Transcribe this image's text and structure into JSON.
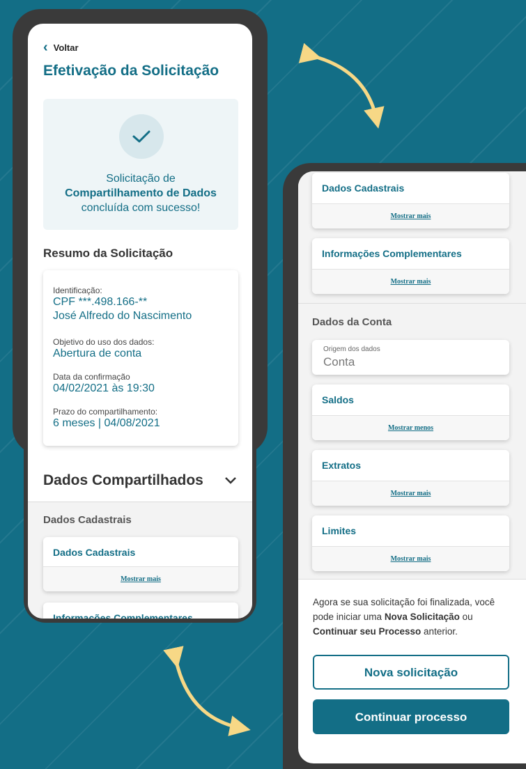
{
  "colors": {
    "accent": "#136e86",
    "background": "#136e86",
    "arrow": "#f7d886"
  },
  "left_screen": {
    "back_label": "Voltar",
    "title": "Efetivação da Solicitação",
    "success": {
      "line1": "Solicitação de",
      "line2": "Compartilhamento de Dados",
      "line3": "concluída com sucesso!",
      "icon": "check-icon"
    },
    "summary_heading": "Resumo da Solicitação",
    "summary": [
      {
        "label": "Identificação:",
        "value": "CPF ***.498.166-**",
        "value2": "José Alfredo do Nascimento"
      },
      {
        "label": "Objetivo do uso dos dados:",
        "value": "Abertura de conta"
      },
      {
        "label": "Data da confirmação",
        "value": "04/02/2021 às 19:30"
      },
      {
        "label": "Prazo do compartilhamento:",
        "value": "6 meses | 04/08/2021"
      }
    ],
    "shared_heading": "Dados Compartilhados",
    "group_label": "Dados Cadastrais",
    "cards": [
      {
        "title": "Dados Cadastrais",
        "action": "Mostrar mais"
      },
      {
        "title": "Informações Complementares"
      }
    ]
  },
  "right_screen": {
    "cards_top": [
      {
        "title": "Dados Cadastrais",
        "action": "Mostrar mais"
      },
      {
        "title": "Informações Complementares",
        "action": "Mostrar mais"
      }
    ],
    "account_heading": "Dados da Conta",
    "origin": {
      "label": "Origem dos dados",
      "value": "Conta"
    },
    "account_cards": [
      {
        "title": "Saldos",
        "action": "Mostrar menos"
      },
      {
        "title": "Extratos",
        "action": "Mostrar mais"
      },
      {
        "title": "Limites",
        "action": "Mostrar mais"
      }
    ],
    "final_message": {
      "part1": "Agora se sua solicitação foi finalizada, você pode iniciar uma ",
      "bold1": "Nova Solicitação",
      "part2": " ou ",
      "bold2": "Continuar seu Processo",
      "part3": " anterior."
    },
    "buttons": {
      "new": "Nova solicitação",
      "continue": "Continuar processo"
    }
  }
}
